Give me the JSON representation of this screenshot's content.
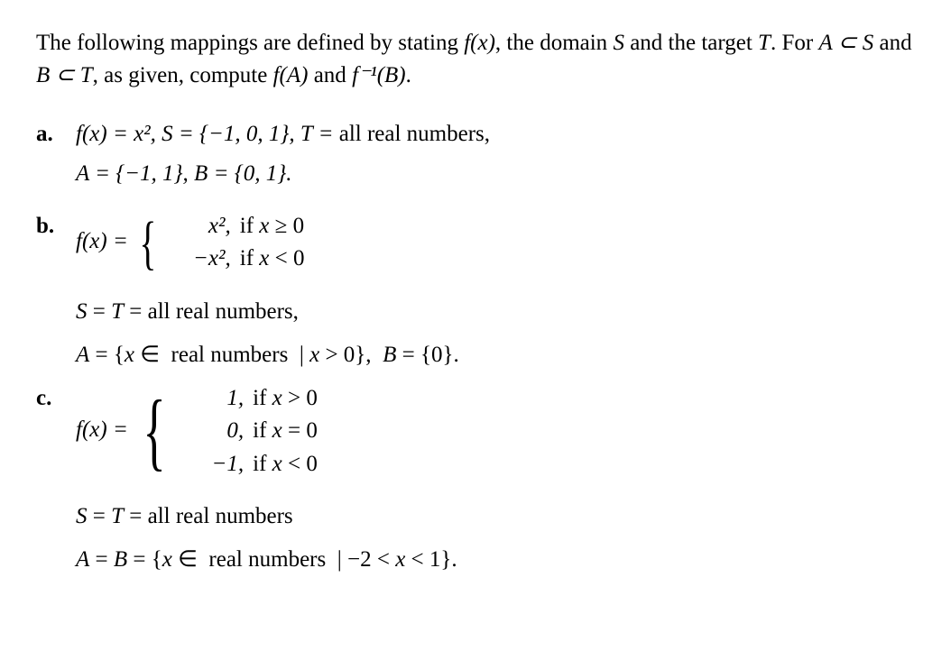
{
  "intro": {
    "part1": "The following mappings are defined by stating ",
    "fx": "f(x)",
    "part2": ", the domain ",
    "S": "S",
    "part3": " and the target ",
    "T": "T",
    "part4": ". For ",
    "Asub": "A ⊂ S",
    "part5": " and ",
    "Bsub": "B ⊂ T",
    "part6": ", as given, compute ",
    "fA": "f(A)",
    "part7": " and ",
    "finvB": "f⁻¹(B)",
    "part8": "."
  },
  "a": {
    "label": "a.",
    "line1_prefix": "f(x) = x²,  S = {−1, 0, 1},  T = ",
    "line1_suffix": "all real numbers,",
    "line2": "A = {−1, 1},  B = {0, 1}."
  },
  "b": {
    "label": "b.",
    "lhs": "f(x) = ",
    "row1_val": "x²,",
    "row1_cond": "if x ≥ 0",
    "row2_val": "−x²,",
    "row2_cond": "if x < 0",
    "line2": "S = T = all real numbers,",
    "line3": "A = {x ∈  real numbers  | x > 0},  B = {0}."
  },
  "c": {
    "label": "c.",
    "lhs": "f(x) = ",
    "row1_val": "1,",
    "row1_cond": "if x > 0",
    "row2_val": "0,",
    "row2_cond": "if x = 0",
    "row3_val": "−1,",
    "row3_cond": "if x < 0",
    "line2": "S = T = all real numbers",
    "line3": "A = B = {x ∈  real numbers  | −2 < x < 1}."
  }
}
